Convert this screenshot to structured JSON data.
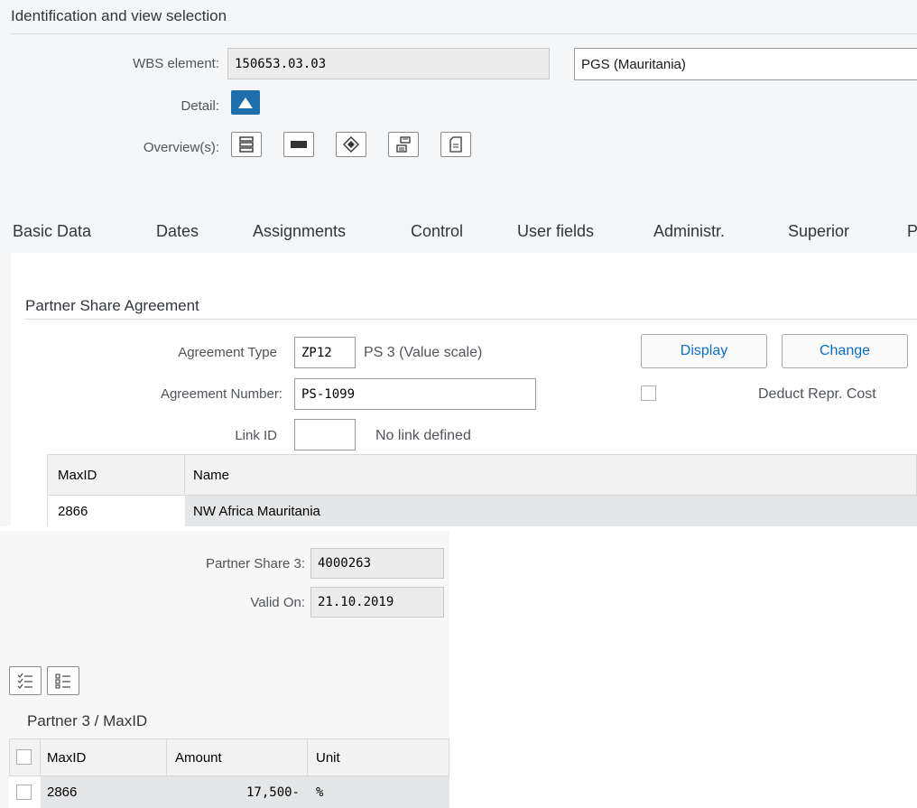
{
  "header": {
    "title": "Identification and view selection"
  },
  "identification": {
    "wbs_label": "WBS element:",
    "wbs_value": "150653.03.03",
    "wbs_description": "PGS (Mauritania)",
    "detail_label": "Detail:",
    "overview_label": "Overview(s):",
    "overview_icons": [
      "hierarchy-icon",
      "flat-list-icon",
      "network-icon",
      "structure-icon",
      "document-icon"
    ]
  },
  "tabs": [
    {
      "label": "Basic Data"
    },
    {
      "label": "Dates"
    },
    {
      "label": "Assignments"
    },
    {
      "label": "Control"
    },
    {
      "label": "User fields"
    },
    {
      "label": "Administr."
    },
    {
      "label": "Superior"
    },
    {
      "label": "P"
    }
  ],
  "agreement": {
    "section_title": "Partner Share Agreement",
    "type_label": "Agreement Type",
    "type_value": "ZP12",
    "type_text": "PS 3 (Value scale)",
    "number_label": "Agreement Number:",
    "number_value": "PS-1099",
    "link_label": "Link ID",
    "link_value": "",
    "link_text": "No link defined",
    "display_button": "Display",
    "change_button": "Change",
    "deduct_label": "Deduct Repr. Cost",
    "deduct_checked": false
  },
  "maxid_table": {
    "columns": [
      "MaxID",
      "Name"
    ],
    "rows": [
      {
        "maxid": "2866",
        "name": "NW Africa Mauritania"
      }
    ]
  },
  "partner_share": {
    "share_label": "Partner Share 3:",
    "share_value": "4000263",
    "valid_label": "Valid On:",
    "valid_value": "21.10.2019",
    "toolbar_icons": [
      "select-all-icon",
      "deselect-all-icon"
    ],
    "table_title": "Partner 3 / MaxID",
    "columns": [
      "MaxID",
      "Amount",
      "Unit"
    ],
    "rows": [
      {
        "maxid": "2866",
        "amount": "17,500-",
        "unit": "%"
      }
    ]
  },
  "colors": {
    "accent": "#1d6fae",
    "link": "#0a6ed1",
    "panel": "#f5f6f7"
  }
}
